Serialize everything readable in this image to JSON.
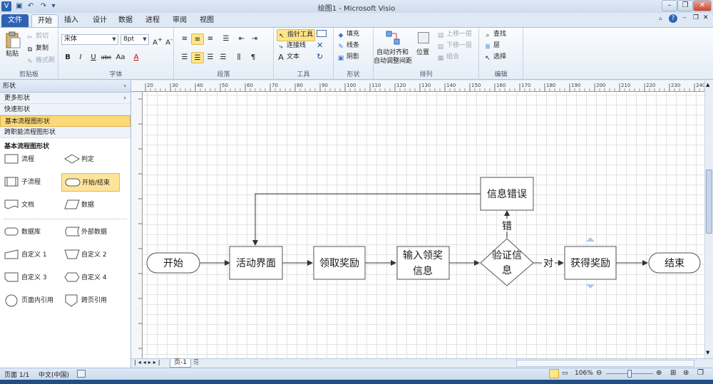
{
  "app": {
    "title": "绘图1 - Microsoft Visio",
    "accent": "#2f63b1"
  },
  "quick_access": {
    "app_icon": "visio-icon",
    "undo_icon": "undo-icon",
    "redo_icon": "redo-icon"
  },
  "tabs": [
    {
      "label": "文件"
    },
    {
      "label": "开始"
    },
    {
      "label": "插入"
    },
    {
      "label": "设计"
    },
    {
      "label": "数据"
    },
    {
      "label": "进程"
    },
    {
      "label": "审阅"
    },
    {
      "label": "视图"
    }
  ],
  "ribbon": {
    "clipboard": {
      "paste": "粘贴",
      "cut": "剪切",
      "copy": "复制",
      "format_painter": "格式刷",
      "label": "剪贴板"
    },
    "font": {
      "name": "宋体",
      "size": "8pt",
      "bold": "B",
      "italic": "I",
      "underline": "U",
      "strike": "abc",
      "case": "Aa",
      "color": "A",
      "label": "字体"
    },
    "paragraph": {
      "label": "段落"
    },
    "tools": {
      "pointer": "指针工具",
      "connector": "连接线",
      "text": "文本",
      "label": "工具"
    },
    "shape": {
      "fill": "填充",
      "line": "线条",
      "shadow": "阴影",
      "label": "形状"
    },
    "arrange": {
      "auto_align": "自动对齐和",
      "auto_space": "自动调整间距",
      "position": "位置",
      "bring_forward": "上移一层",
      "send_backward": "下移一层",
      "group": "组合",
      "label": "排列"
    },
    "editing": {
      "find": "查找",
      "layers": "层",
      "select": "选择",
      "label": "编辑"
    }
  },
  "shapes_panel": {
    "title": "形状",
    "nav": [
      {
        "label": "更多形状"
      },
      {
        "label": "快速形状"
      },
      {
        "label": "基本流程图形状"
      },
      {
        "label": "跨职能流程图形状"
      }
    ],
    "stencil_title": "基本流程图形状",
    "stencils": [
      {
        "label": "流程"
      },
      {
        "label": "判定"
      },
      {
        "label": "子流程"
      },
      {
        "label": "开始/结束"
      },
      {
        "label": "文档"
      },
      {
        "label": "数据"
      },
      {
        "label": "数据库"
      },
      {
        "label": "外部数据"
      },
      {
        "label": "自定义 1"
      },
      {
        "label": "自定义 2"
      },
      {
        "label": "自定义 3"
      },
      {
        "label": "自定义 4"
      },
      {
        "label": "页面内引用"
      },
      {
        "label": "跨页引用"
      }
    ]
  },
  "ruler": {
    "top_ticks": [
      "20",
      "30",
      "40",
      "50",
      "60",
      "70",
      "80",
      "90",
      "100",
      "110",
      "120",
      "130",
      "140",
      "150",
      "160",
      "170",
      "180",
      "190",
      "200",
      "210",
      "220",
      "230",
      "240"
    ]
  },
  "flowchart": {
    "nodes": [
      {
        "id": "start",
        "label": "开始"
      },
      {
        "id": "ui",
        "label": "活动界面"
      },
      {
        "id": "claim",
        "label": "领取奖励"
      },
      {
        "id": "input1",
        "label": "输入领奖"
      },
      {
        "id": "input2",
        "label": "信息"
      },
      {
        "id": "verify1",
        "label": "验证信"
      },
      {
        "id": "verify2",
        "label": "息"
      },
      {
        "id": "error",
        "label": "信息错误"
      },
      {
        "id": "reward",
        "label": "获得奖励"
      },
      {
        "id": "end",
        "label": "结束"
      }
    ],
    "edge_labels": {
      "wrong": "错",
      "right": "对"
    }
  },
  "page_tabs": {
    "current": "页-1"
  },
  "status": {
    "page": "页面 1/1",
    "language": "中文(中国)",
    "zoom": "106%"
  }
}
